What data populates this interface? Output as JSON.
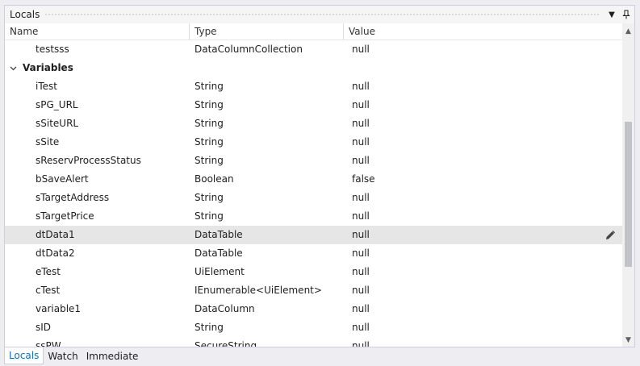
{
  "panel": {
    "title": "Locals"
  },
  "columns": {
    "name": "Name",
    "type": "Type",
    "value": "Value"
  },
  "rows": [
    {
      "kind": "item",
      "name": "testsss",
      "type": "DataColumnCollection",
      "value": "null"
    },
    {
      "kind": "group",
      "name": "Variables"
    },
    {
      "kind": "item",
      "name": "iTest",
      "type": "String",
      "value": "null"
    },
    {
      "kind": "item",
      "name": "sPG_URL",
      "type": "String",
      "value": "null"
    },
    {
      "kind": "item",
      "name": "sSiteURL",
      "type": "String",
      "value": "null"
    },
    {
      "kind": "item",
      "name": "sSite",
      "type": "String",
      "value": "null"
    },
    {
      "kind": "item",
      "name": "sReservProcessStatus",
      "type": "String",
      "value": "null"
    },
    {
      "kind": "item",
      "name": "bSaveAlert",
      "type": "Boolean",
      "value": "false"
    },
    {
      "kind": "item",
      "name": "sTargetAddress",
      "type": "String",
      "value": "null"
    },
    {
      "kind": "item",
      "name": "sTargetPrice",
      "type": "String",
      "value": "null"
    },
    {
      "kind": "item",
      "name": "dtData1",
      "type": "DataTable",
      "value": "null",
      "selected": true
    },
    {
      "kind": "item",
      "name": "dtData2",
      "type": "DataTable",
      "value": "null"
    },
    {
      "kind": "item",
      "name": "eTest",
      "type": "UiElement",
      "value": "null"
    },
    {
      "kind": "item",
      "name": "cTest",
      "type": "IEnumerable<UiElement>",
      "value": "null"
    },
    {
      "kind": "item",
      "name": "variable1",
      "type": "DataColumn",
      "value": "null"
    },
    {
      "kind": "item",
      "name": "sID",
      "type": "String",
      "value": "null"
    },
    {
      "kind": "item",
      "name": "ssPW",
      "type": "SecureString",
      "value": "null"
    }
  ],
  "tabs": [
    {
      "label": "Locals",
      "active": true
    },
    {
      "label": "Watch",
      "active": false
    },
    {
      "label": "Immediate",
      "active": false
    }
  ],
  "colors": {
    "accent": "#0e70c0",
    "selection": "#e6e6e6"
  },
  "icons": {
    "edit": "pencil-icon",
    "expand": "chevron-down-icon"
  }
}
